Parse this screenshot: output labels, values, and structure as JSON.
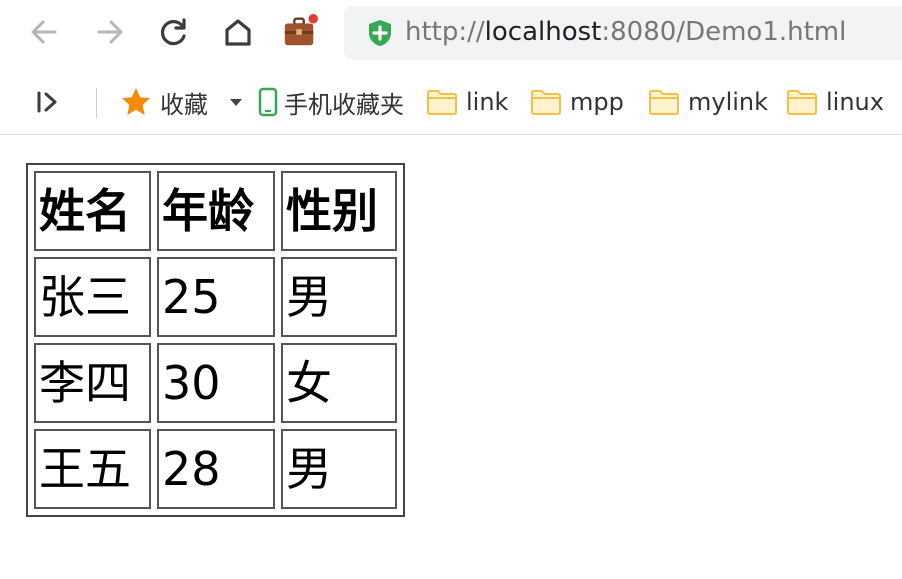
{
  "browser": {
    "url_scheme": "http://",
    "url_host": "localhost",
    "url_rest": ":8080/Demo1.html"
  },
  "bookmarks": {
    "favorites_label": "收藏",
    "items": [
      {
        "label": "手机收藏夹",
        "icon": "phone-icon"
      },
      {
        "label": "link",
        "icon": "folder-icon"
      },
      {
        "label": "mpp",
        "icon": "folder-icon"
      },
      {
        "label": "mylink",
        "icon": "folder-icon"
      },
      {
        "label": "linux",
        "icon": "folder-icon"
      }
    ]
  },
  "table": {
    "headers": [
      "姓名",
      "年龄",
      "性别"
    ],
    "rows": [
      [
        "张三",
        "25",
        "男"
      ],
      [
        "李四",
        "30",
        "女"
      ],
      [
        "王五",
        "28",
        "男"
      ]
    ]
  },
  "colors": {
    "folder": "#f2c14b",
    "star": "#f58a07",
    "secure": "#34a853",
    "badge": "#e53935"
  }
}
